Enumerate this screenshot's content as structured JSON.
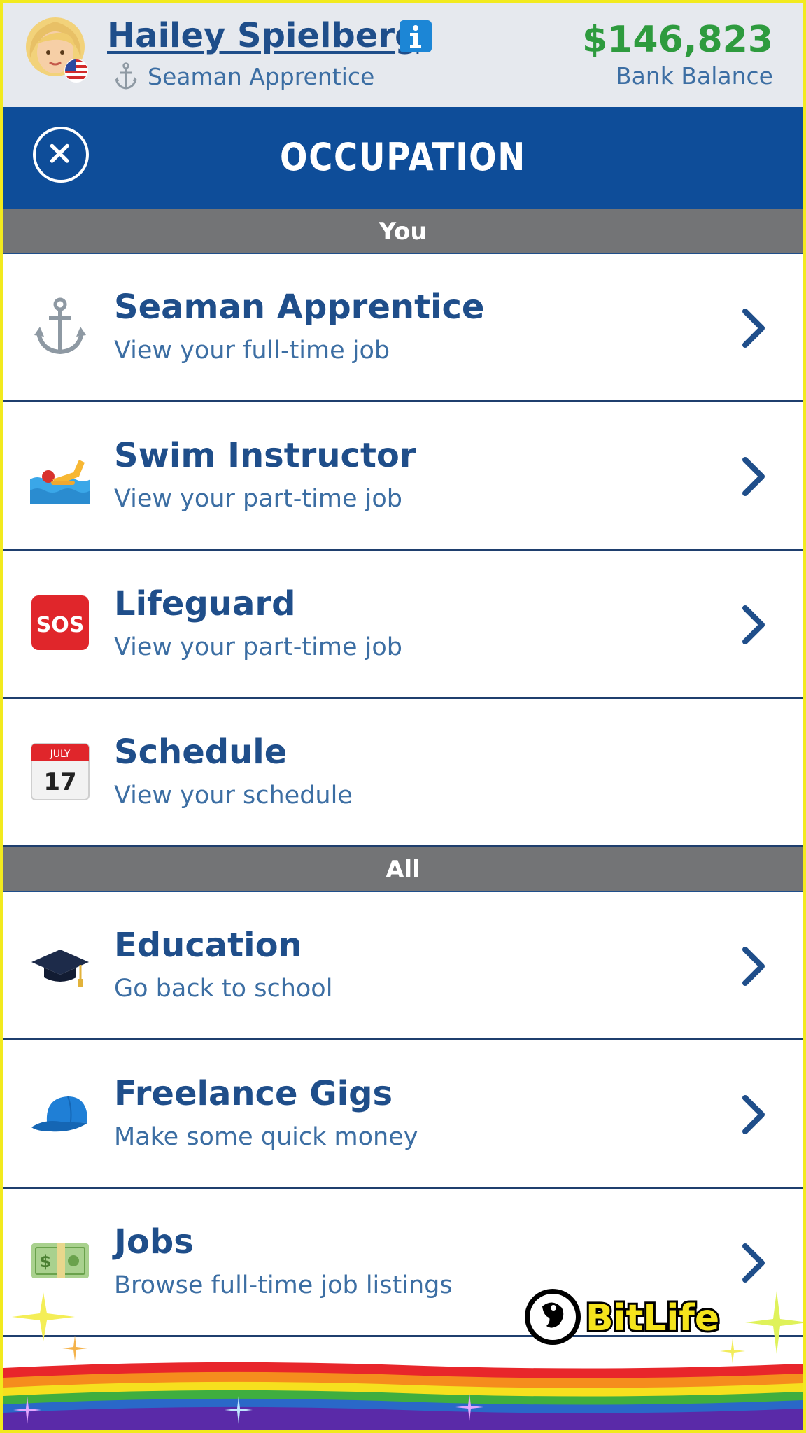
{
  "header": {
    "name": "Hailey Spielberg",
    "job": "Seaman Apprentice",
    "balance": "$146,823",
    "balance_label": "Bank Balance"
  },
  "titlebar": {
    "title": "OCCUPATION"
  },
  "sections": {
    "you": "You",
    "all": "All"
  },
  "rows": [
    {
      "title": "Seaman Apprentice",
      "subtitle": "View your full-time job",
      "icon": "anchor-icon"
    },
    {
      "title": "Swim Instructor",
      "subtitle": "View your part-time job",
      "icon": "swimmer-icon"
    },
    {
      "title": "Lifeguard",
      "subtitle": "View your part-time job",
      "icon": "sos-icon"
    },
    {
      "title": "Schedule",
      "subtitle": "View your schedule",
      "icon": "calendar-icon",
      "calendar_month": "JULY",
      "calendar_day": "17"
    },
    {
      "title": "Education",
      "subtitle": "Go back to school",
      "icon": "graduation-cap-icon"
    },
    {
      "title": "Freelance Gigs",
      "subtitle": "Make some quick money",
      "icon": "cap-icon"
    },
    {
      "title": "Jobs",
      "subtitle": "Browse full-time job listings",
      "icon": "money-icon"
    }
  ],
  "branding": {
    "logo_text": "BitLife"
  },
  "colors": {
    "border": "#f2ea1e",
    "header_bg": "#e6e9ee",
    "title_bar": "#0e4d99",
    "section_bg": "#737476",
    "text_blue": "#1f4e8a",
    "money_green": "#2e9b3e"
  }
}
